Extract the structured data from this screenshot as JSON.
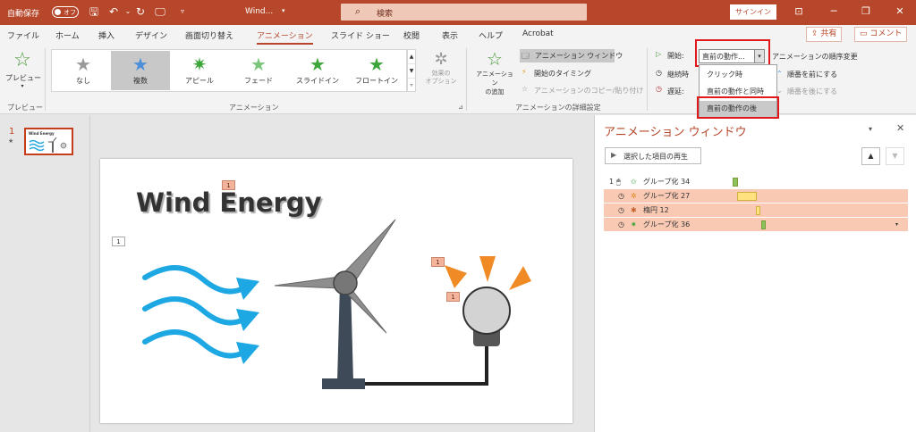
{
  "titlebar": {
    "autosave_label": "自動保存",
    "autosave_state": "オフ",
    "filename": "Wind...",
    "search_placeholder": "検索",
    "signin_label": "サインイン",
    "bg_color": "#b7472a"
  },
  "tabs": [
    "ファイル",
    "ホーム",
    "挿入",
    "デザイン",
    "画面切り替え",
    "アニメーション",
    "スライド ショー",
    "校閲",
    "表示",
    "ヘルプ",
    "Acrobat"
  ],
  "active_tab": "アニメーション",
  "share_label": "共有",
  "comment_label": "コメント",
  "ribbon": {
    "preview_label": "プレビュー",
    "preview_group": "プレビュー",
    "gallery": [
      {
        "label": "なし",
        "icon": "star-outline-gray-icon"
      },
      {
        "label": "複数",
        "icon": "star-blue-icon"
      },
      {
        "label": "アピール",
        "icon": "star-green-burst-icon"
      },
      {
        "label": "フェード",
        "icon": "star-green-fade-icon"
      },
      {
        "label": "スライドイン",
        "icon": "star-green-slide-icon"
      },
      {
        "label": "フロートイン",
        "icon": "star-green-float-icon"
      }
    ],
    "effect_options_label": "効果の\nオプション",
    "animation_group": "アニメーション",
    "add_animation_label": "アニメーション\nの追加",
    "animation_pane_label": "アニメーション ウィンドウ",
    "trigger_label": "開始のタイミング",
    "painter_label": "アニメーションのコピー/貼り付け",
    "advanced_group": "アニメーションの詳細設定",
    "start_label": "開始:",
    "start_value": "直前の動作...",
    "duration_label": "継続時",
    "delay_label": "遅延:",
    "reorder_label": "アニメーションの順序変更",
    "move_earlier": "順番を前にする",
    "move_later": "順番を後にする",
    "dropdown_options": [
      "クリック時",
      "直前の動作と同時",
      "直前の動作の後"
    ],
    "dropdown_selected": "直前の動作の後"
  },
  "thumbnail": {
    "number": "1",
    "star": "★",
    "title": "Wind Energy"
  },
  "slide": {
    "title": "Wind Energy",
    "tags": [
      "1",
      "1",
      "1",
      "1"
    ]
  },
  "anim_pane": {
    "title": "アニメーション ウィンドウ",
    "play_label": "選択した項目の再生",
    "items": [
      {
        "index": "1",
        "trigger": "mouse-icon",
        "effect": "star-green-icon",
        "name": "グループ化 34",
        "bar_color": "#8cc35a",
        "bar_start": 0,
        "bar_len": 0.05
      },
      {
        "index": "",
        "trigger": "clock-icon",
        "effect": "star-orange-icon",
        "name": "グループ化 27",
        "bar_color": "#ffe280",
        "bar_start": 0.05,
        "bar_len": 0.22
      },
      {
        "index": "",
        "trigger": "clock-icon",
        "effect": "star-mixed-icon",
        "name": "楕円 12",
        "bar_color": "#ffe280",
        "bar_start": 0.27,
        "bar_len": 0.05
      },
      {
        "index": "",
        "trigger": "clock-icon",
        "effect": "star-green-burst-icon",
        "name": "グループ化 36",
        "bar_color": "#8cc35a",
        "bar_start": 0.34,
        "bar_len": 0.05
      }
    ]
  }
}
